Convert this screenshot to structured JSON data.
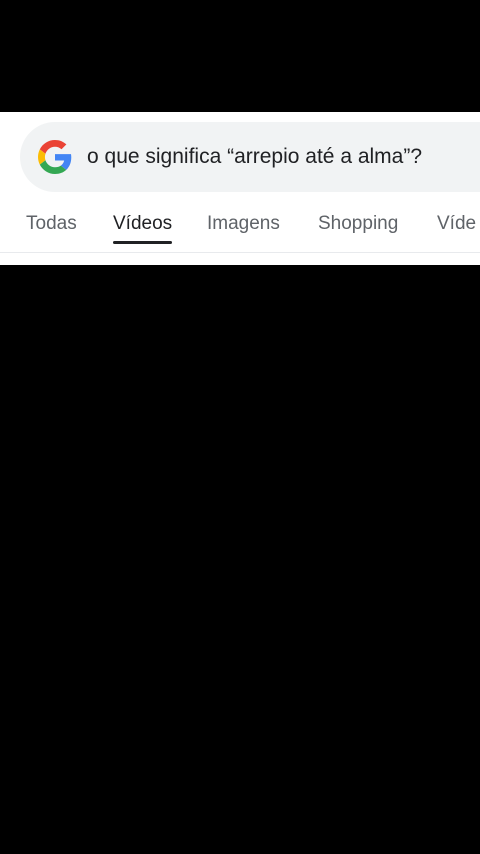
{
  "search": {
    "query": "o que significa “arrepio até a alma”?"
  },
  "tabs": [
    {
      "label": "Todas",
      "active": false
    },
    {
      "label": "Vídeos",
      "active": true
    },
    {
      "label": "Imagens",
      "active": false
    },
    {
      "label": "Shopping",
      "active": false
    },
    {
      "label": "Víde",
      "active": false
    }
  ],
  "icons": {
    "logo": "google-g-icon"
  },
  "colors": {
    "background": "#000000",
    "panel": "#ffffff",
    "search_bg": "#f1f3f4",
    "active_tab": "#202124",
    "inactive_tab": "#5f6368",
    "google_blue": "#4285F4",
    "google_red": "#EA4335",
    "google_yellow": "#FBBC05",
    "google_green": "#34A853"
  }
}
